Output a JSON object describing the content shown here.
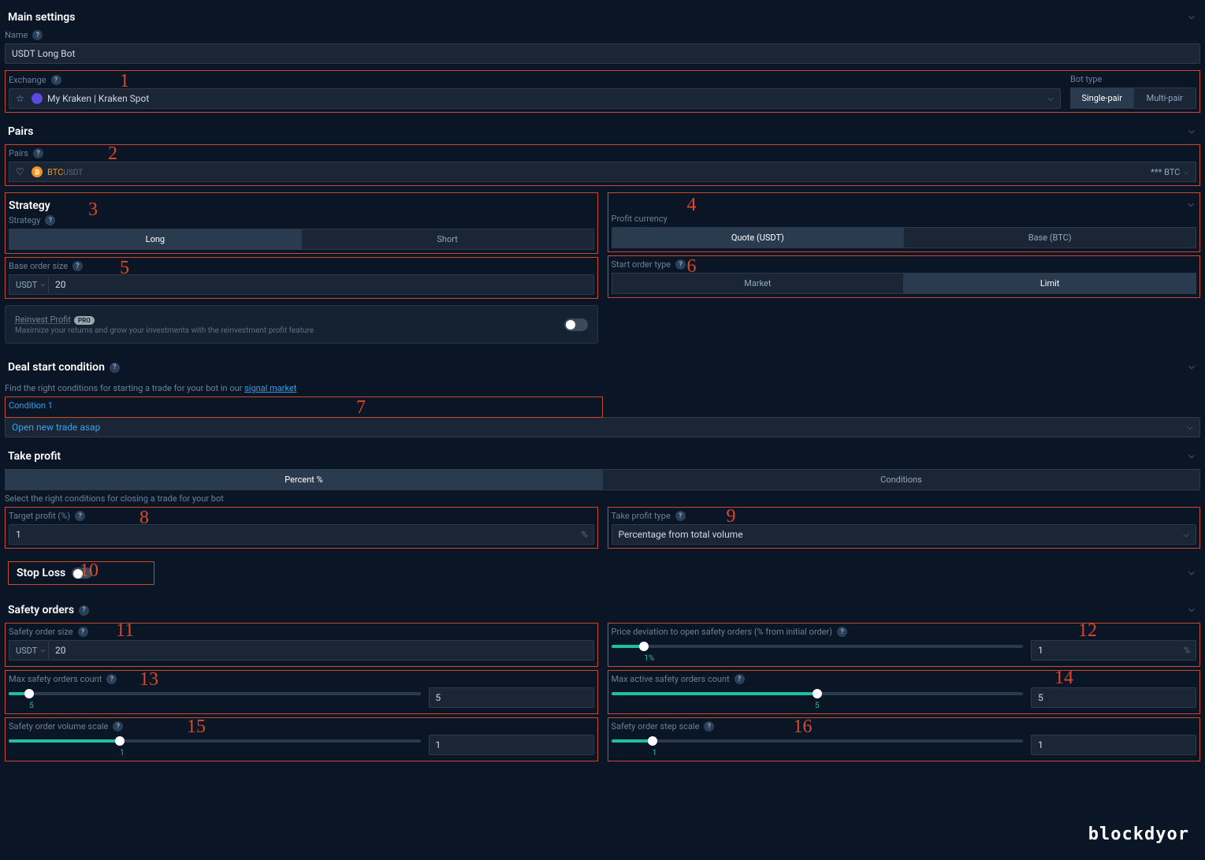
{
  "sections": {
    "main": {
      "title": "Main settings"
    },
    "pairs": {
      "title": "Pairs"
    },
    "strategy": {
      "title": "Strategy"
    },
    "dealStart": {
      "title": "Deal start condition"
    },
    "takeProfit": {
      "title": "Take profit"
    },
    "stopLoss": {
      "title": "Stop Loss"
    },
    "safetyOrders": {
      "title": "Safety orders"
    }
  },
  "main": {
    "nameLabel": "Name",
    "nameValue": "USDT Long Bot",
    "exchangeLabel": "Exchange",
    "exchangeValue": "My Kraken | Kraken Spot",
    "botTypeLabel": "Bot type",
    "botTypeSingle": "Single-pair",
    "botTypeMulti": "Multi-pair"
  },
  "pairs": {
    "label": "Pairs",
    "symbolBase": "BTC",
    "symbolQuote": "USDT",
    "right": "*** BTC"
  },
  "strategy": {
    "label": "Strategy",
    "long": "Long",
    "short": "Short",
    "baseOrderLabel": "Base order size",
    "baseOrderCurrency": "USDT",
    "baseOrderValue": "20",
    "profitCurrencyLabel": "Profit currency",
    "quoteOpt": "Quote (USDT)",
    "baseOpt": "Base (BTC)",
    "startOrderLabel": "Start order type",
    "market": "Market",
    "limit": "Limit",
    "reinvestTitle": "Reinvest Profit",
    "proBadge": "PRO",
    "reinvestSub": "Maximize your returns and grow your investments with the reinvestment profit feature"
  },
  "dealStart": {
    "infoPrefix": "Find the right conditions for starting a trade for your bot in our ",
    "infoLink": "signal market",
    "conditionLabel": "Condition 1",
    "conditionValue": "Open new trade asap"
  },
  "takeProfit": {
    "percentTab": "Percent %",
    "conditionsTab": "Conditions",
    "info": "Select the right conditions for closing a trade for your bot",
    "targetLabel": "Target profit (%)",
    "targetValue": "1",
    "typeLabel": "Take profit type",
    "typeValue": "Percentage from total volume"
  },
  "safetyOrders": {
    "sizeLabel": "Safety order size",
    "sizeCurrency": "USDT",
    "sizeValue": "20",
    "priceDevLabel": "Price deviation to open safety orders (% from initial order)",
    "priceDevValue": "1",
    "priceDevDisplay": "1%",
    "maxCountLabel": "Max safety orders count",
    "maxCountValue": "5",
    "maxCountDisplay": "5",
    "maxActiveLabel": "Max active safety orders count",
    "maxActiveValue": "5",
    "maxActiveDisplay": "5",
    "volScaleLabel": "Safety order volume scale",
    "volScaleValue": "1",
    "volScaleDisplay": "1",
    "stepScaleLabel": "Safety order step scale",
    "stepScaleValue": "1",
    "stepScaleDisplay": "1"
  },
  "annotations": {
    "a1": "1",
    "a2": "2",
    "a3": "3",
    "a4": "4",
    "a5": "5",
    "a6": "6",
    "a7": "7",
    "a8": "8",
    "a9": "9",
    "a10": "10",
    "a11": "11",
    "a12": "12",
    "a13": "13",
    "a14": "14",
    "a15": "15",
    "a16": "16"
  },
  "watermark": "blockdyor"
}
